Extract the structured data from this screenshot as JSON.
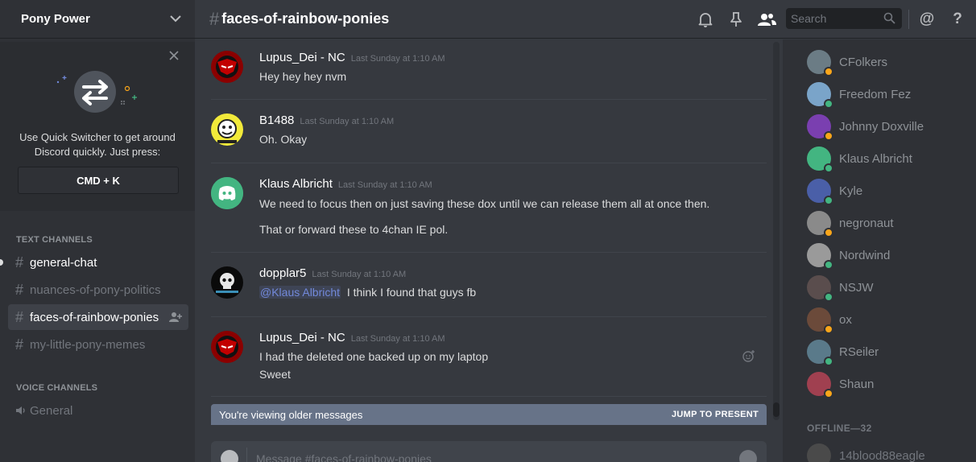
{
  "server": {
    "name": "Pony Power"
  },
  "quick_switcher": {
    "text": "Use Quick Switcher to get around Discord quickly. Just press:",
    "shortcut": "CMD + K"
  },
  "sidebar": {
    "text_header": "TEXT CHANNELS",
    "text_channels": [
      {
        "name": "general-chat",
        "state": "unread"
      },
      {
        "name": "nuances-of-pony-politics",
        "state": "muted"
      },
      {
        "name": "faces-of-rainbow-ponies",
        "state": "active"
      },
      {
        "name": "my-little-pony-memes",
        "state": "muted"
      }
    ],
    "voice_header": "VOICE CHANNELS",
    "voice_channels": [
      {
        "name": "General"
      }
    ]
  },
  "topbar": {
    "hash": "#",
    "channel": "faces-of-rainbow-ponies",
    "search_placeholder": "Search",
    "icons": [
      "bell-icon",
      "pin-icon",
      "members-icon",
      "search-icon",
      "mention-icon",
      "help-icon"
    ],
    "mention": "@",
    "help": "?"
  },
  "messages": [
    {
      "author": "Lupus_Dei - NC",
      "time": "Last Sunday at 1:10 AM",
      "lines": [
        "Hey hey hey nvm"
      ]
    },
    {
      "author": "B1488",
      "time": "Last Sunday at 1:10 AM",
      "lines": [
        "Oh. Okay"
      ]
    },
    {
      "author": "Klaus Albricht",
      "time": "Last Sunday at 1:10 AM",
      "lines": [
        "We need to focus then on just saving these dox until we can release them all at once then.",
        "That or forward these to 4chan IE pol."
      ]
    },
    {
      "author": "dopplar5",
      "time": "Last Sunday at 1:10 AM",
      "mention": "@Klaus Albricht",
      "lines": [
        "I think I found that guys fb"
      ]
    },
    {
      "author": "Lupus_Dei - NC",
      "time": "Last Sunday at 1:10 AM",
      "lines": [
        "I had the deleted one backed up on my laptop",
        "Sweet"
      ]
    }
  ],
  "older_bar": {
    "text": "You're viewing older messages",
    "jump": "JUMP TO PRESENT"
  },
  "composer": {
    "placeholder": "Message #faces-of-rainbow-ponies"
  },
  "members": {
    "online": [
      {
        "name": "CFolkers",
        "status": "idle"
      },
      {
        "name": "Freedom Fez",
        "status": "online"
      },
      {
        "name": "Johnny Doxville",
        "status": "idle"
      },
      {
        "name": "Klaus Albricht",
        "status": "online"
      },
      {
        "name": "Kyle",
        "status": "online"
      },
      {
        "name": "negronaut",
        "status": "idle"
      },
      {
        "name": "Nordwind",
        "status": "online"
      },
      {
        "name": "NSJW",
        "status": "online"
      },
      {
        "name": "ox",
        "status": "idle"
      },
      {
        "name": "RSeiler",
        "status": "online"
      },
      {
        "name": "Shaun",
        "status": "idle"
      }
    ],
    "offline_header": "OFFLINE—32",
    "offline": [
      {
        "name": "14blood88eagle"
      }
    ]
  },
  "colors": {
    "accent": "#7289da",
    "idle": "#faa61a",
    "online": "#43b581",
    "discord_blurple": "#43b581"
  }
}
